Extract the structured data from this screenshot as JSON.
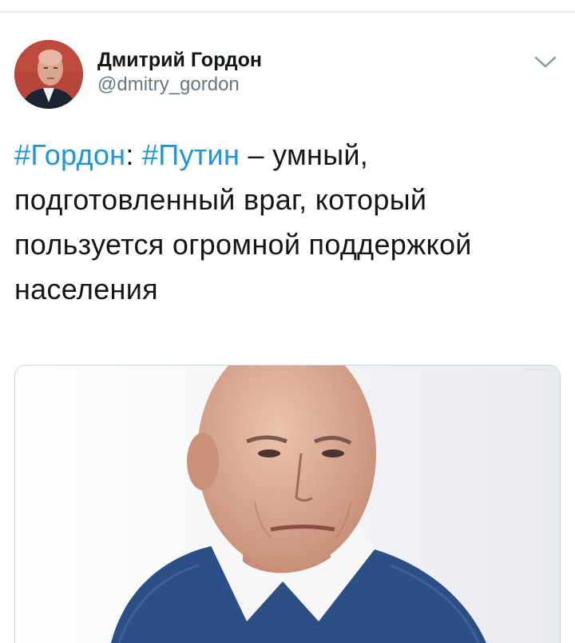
{
  "author": {
    "display_name": "Дмитрий Гордон",
    "handle": "@dmitry_gordon",
    "avatar_icon": "person-portrait",
    "avatar_bg": "#b24436"
  },
  "tweet": {
    "hashtag_1": "#Гордон",
    "sep_1": ": ",
    "hashtag_2": "#Путин",
    "body": " – умный, подготовленный враг, который пользуется огромной поддержкой населения"
  },
  "media": {
    "icon": "photo-portrait"
  },
  "colors": {
    "link": "#1b95e0",
    "text": "#14171a",
    "muted": "#657786",
    "border": "#ccd6dd"
  }
}
